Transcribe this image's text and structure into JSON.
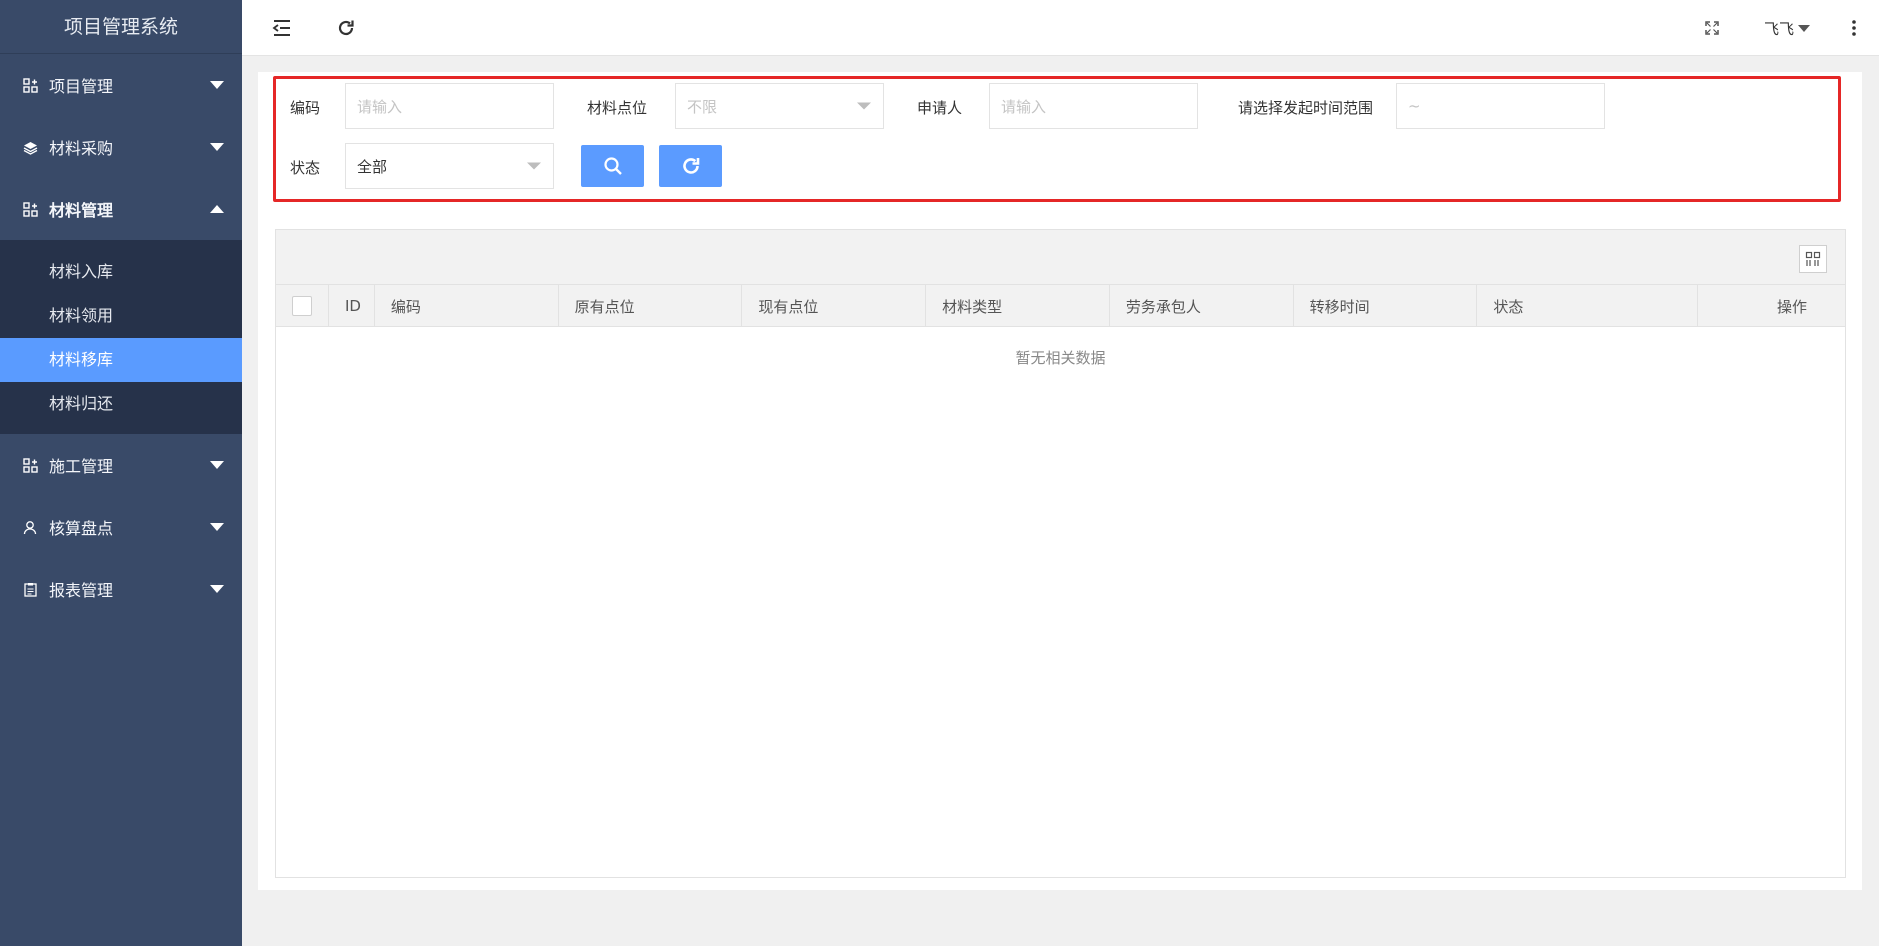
{
  "app": {
    "title": "项目管理系统"
  },
  "sidebar": {
    "groups": [
      {
        "label": "项目管理",
        "icon": "modules-icon",
        "expanded": false
      },
      {
        "label": "材料采购",
        "icon": "layers-icon",
        "expanded": false
      },
      {
        "label": "材料管理",
        "icon": "modules-icon",
        "expanded": true,
        "items": [
          {
            "label": "材料入库",
            "active": false
          },
          {
            "label": "材料领用",
            "active": false
          },
          {
            "label": "材料移库",
            "active": true
          },
          {
            "label": "材料归还",
            "active": false
          }
        ]
      },
      {
        "label": "施工管理",
        "icon": "modules-icon",
        "expanded": false
      },
      {
        "label": "核算盘点",
        "icon": "user-icon",
        "expanded": false
      },
      {
        "label": "报表管理",
        "icon": "clipboard-icon",
        "expanded": false
      }
    ]
  },
  "topbar": {
    "user_name": "飞飞",
    "icons": [
      "menu-collapse-icon",
      "refresh-icon",
      "fullscreen-icon",
      "more-vertical-icon"
    ]
  },
  "filters": {
    "code_label": "编码",
    "code_placeholder": "请输入",
    "location_label": "材料点位",
    "location_value": "不限",
    "applicant_label": "申请人",
    "applicant_placeholder": "请输入",
    "time_label": "请选择发起时间范围",
    "time_value": "~",
    "status_label": "状态",
    "status_value": "全部"
  },
  "table": {
    "columns": [
      "ID",
      "编码",
      "原有点位",
      "现有点位",
      "材料类型",
      "劳务承包人",
      "转移时间",
      "状态",
      "操作"
    ],
    "empty_text": "暂无相关数据"
  },
  "colors": {
    "sidebar": "#394a68",
    "submenu": "#26324a",
    "accent": "#5a9bff",
    "highlight_border": "#e52727"
  }
}
